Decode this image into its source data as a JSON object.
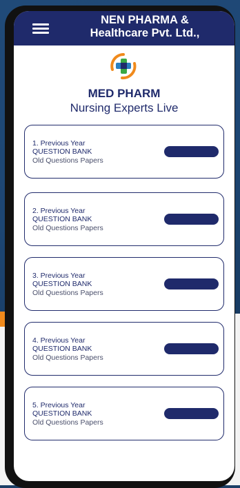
{
  "header": {
    "title_line1": "NEN PHARMA &",
    "title_line2": "Healthcare Pvt. Ltd.,"
  },
  "brand": {
    "name": "MED PHARM",
    "tagline": "Nursing Experts Live"
  },
  "cards": [
    {
      "line1": "1. Previous Year",
      "line2": "QUESTION BANK",
      "line3": "Old Questions Papers"
    },
    {
      "line1": "2. Previous Year",
      "line2": "QUESTION BANK",
      "line3": "Old Questions Papers"
    },
    {
      "line1": "3. Previous Year",
      "line2": "QUESTION BANK",
      "line3": "Old Questions Papers"
    },
    {
      "line1": "4. Previous Year",
      "line2": "QUESTION BANK",
      "line3": "Old Questions Papers"
    },
    {
      "line1": "5. Previous Year",
      "line2": "QUESTION BANK",
      "line3": "Old Questions Papers"
    }
  ],
  "icons": {
    "menu": "hamburger-menu-icon",
    "logo": "medical-cross-logo-icon"
  },
  "colors": {
    "primary": "#1f2a6b",
    "accent_orange": "#f08a1c",
    "accent_green": "#3aa844",
    "accent_blue": "#2a7fc1"
  }
}
